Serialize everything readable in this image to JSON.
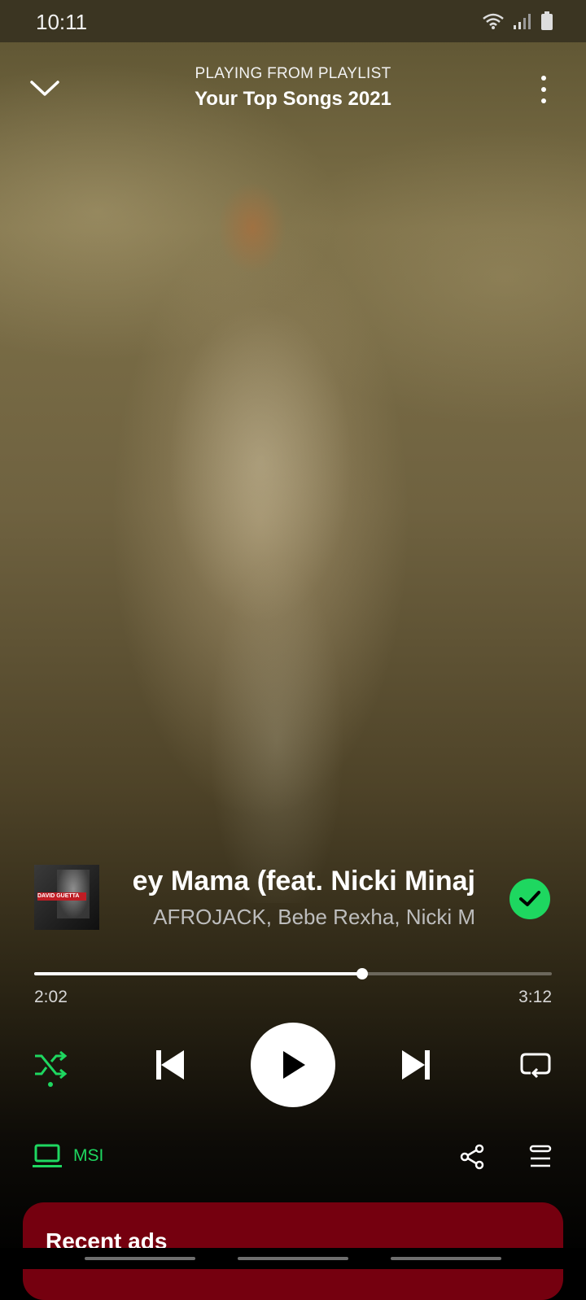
{
  "status_bar": {
    "time": "10:11"
  },
  "header": {
    "subtitle": "PLAYING FROM PLAYLIST",
    "playlist": "Your Top Songs 2021",
    "collapse_icon": "chevron-down-icon",
    "more_icon": "more-vertical-icon"
  },
  "track": {
    "title": "ey Mama (feat. Nicki Minaj",
    "artists": "AFROJACK, Bebe Rexha, Nicki M",
    "cover_text": "DAVID GUETTA",
    "liked": true
  },
  "playback": {
    "elapsed": "2:02",
    "duration": "3:12",
    "progress_fraction": 0.634,
    "shuffle_enabled": true
  },
  "device": {
    "name": "MSI",
    "icon": "laptop-icon"
  },
  "ads": {
    "title": "Recent ads"
  },
  "colors": {
    "accent": "#1ed760",
    "ads_card": "#75000f"
  }
}
